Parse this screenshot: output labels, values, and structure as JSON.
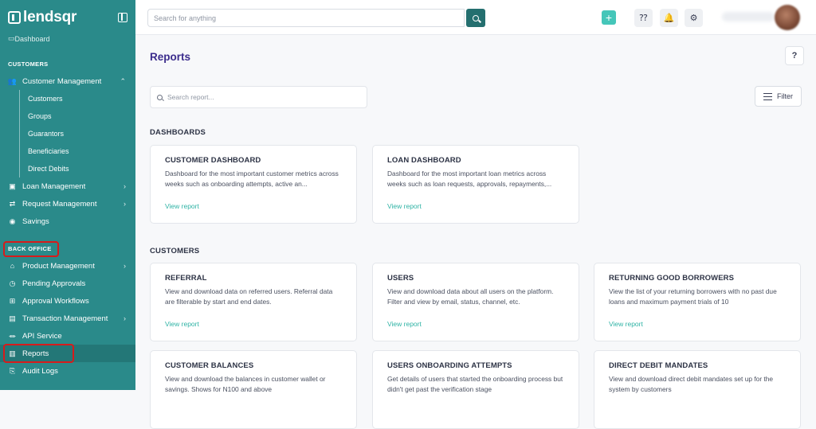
{
  "app": {
    "brand": "lendsqr"
  },
  "sidebar": {
    "partial_item": "Dashboard",
    "customers_section": "CUSTOMERS",
    "customer_management": "Customer Management",
    "customer_sub": [
      "Customers",
      "Groups",
      "Guarantors",
      "Beneficiaries",
      "Direct Debits"
    ],
    "loan_management": "Loan Management",
    "request_management": "Request Management",
    "savings": "Savings",
    "back_office_section": "BACK OFFICE",
    "product_management": "Product Management",
    "pending_approvals": "Pending Approvals",
    "approval_workflows": "Approval Workflows",
    "transaction_management": "Transaction Management",
    "api_service": "API Service",
    "reports": "Reports",
    "audit_logs": "Audit Logs"
  },
  "topbar": {
    "search_placeholder": "Search for anything",
    "add_icon": "plus-icon"
  },
  "main": {
    "title": "Reports",
    "report_search_placeholder": "Search report...",
    "filter_label": "Filter",
    "dashboards_heading": "DASHBOARDS",
    "customers_heading": "CUSTOMERS",
    "view_label": "View report",
    "dashboards": [
      {
        "title": "CUSTOMER DASHBOARD",
        "desc": "Dashboard for the most important customer metrics across weeks such as onboarding attempts, active an..."
      },
      {
        "title": "LOAN DASHBOARD",
        "desc": "Dashboard for the most important loan metrics across weeks such as loan requests, approvals, repayments,..."
      }
    ],
    "customers": [
      {
        "title": "REFERRAL",
        "desc": "View and download data on referred users. Referral data are filterable by start and end dates."
      },
      {
        "title": "USERS",
        "desc": "View and download data about all users on the platform. Filter and view by email, status, channel, etc."
      },
      {
        "title": "RETURNING GOOD BORROWERS",
        "desc": "View the list of your returning borrowers with no past due loans and maximum payment trials of 10"
      },
      {
        "title": "CUSTOMER BALANCES",
        "desc": "View and download the balances in customer wallet or savings. Shows for N100 and above"
      },
      {
        "title": "USERS ONBOARDING ATTEMPTS",
        "desc": "Get details of users that started the onboarding process but didn't get past the verification stage"
      },
      {
        "title": "DIRECT DEBIT MANDATES",
        "desc": "View and download direct debit mandates set up for the system by customers"
      }
    ]
  },
  "colors": {
    "sidebar": "#2a8a8a",
    "accent": "#2fb3a5",
    "title": "#3b2c8c",
    "highlight": "#d81b1b"
  }
}
